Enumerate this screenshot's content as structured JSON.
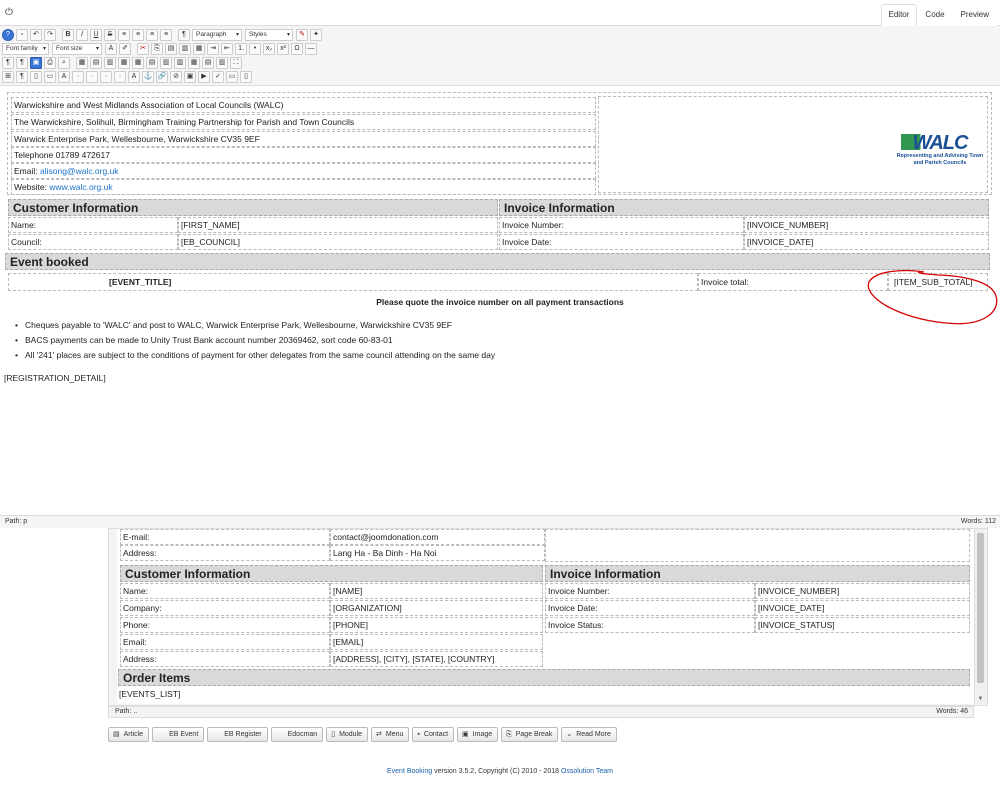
{
  "top_tabs": [
    "Editor",
    "Code",
    "Preview"
  ],
  "toolbar": {
    "format_select": "Paragraph",
    "styles_select": "Styles",
    "font_family_select": "Font family",
    "font_size_select": "Font size"
  },
  "header": {
    "lines": [
      "Warwickshire and West Midlands Association of Local Councils (WALC)",
      "The Warwickshire, Solihull, Birmingham Training Partnership for Parish and Town Councils",
      "Warwick Enterprise Park, Wellesbourne, Warwickshire CV35 9EF",
      "Telephone 01789 472617"
    ],
    "email_label": "Email:",
    "email": "alisong@walc.org.uk",
    "website_label": "Website:",
    "website": "www.walc.org.uk",
    "logo_text": "WALC",
    "logo_tagline": "Representing and Advising Town and Parish Councils"
  },
  "customer_info": {
    "heading": "Customer Information",
    "name_label": "Name:",
    "name_value": "[FIRST_NAME]",
    "council_label": "Council:",
    "council_value": "[EB_COUNCIL]"
  },
  "invoice_info": {
    "heading": "Invoice Information",
    "number_label": "Invoice Number:",
    "number_value": "[INVOICE_NUMBER]",
    "date_label": "Invoice Date:",
    "date_value": "[INVOICE_DATE]"
  },
  "event_booked": {
    "heading": "Event booked",
    "title": "[EVENT_TITLE]",
    "total_label": "Invoice total:",
    "total_value": "[ITEM_SUB_TOTAL]"
  },
  "quote_notice": "Please quote the invoice number on all payment transactions",
  "bullets": [
    "Cheques payable to 'WALC' and post to WALC, Warwick Enterprise Park, Wellesbourne, Warwickshire CV35 9EF",
    "BACS payments can be made to Unity Trust Bank account number 20369462, sort code 60-83-01",
    "All '241' places are subject to the conditions of payment for other delegates from the same council attending on the same day"
  ],
  "registration_detail": "[REGISTRATION_DETAIL]",
  "status": {
    "path": "Path: p",
    "words": "Words: 112"
  },
  "lower": {
    "email_label": "E-mail:",
    "email_value": "contact@joomdonation.com",
    "address_label": "Address:",
    "address_value": "Lang Ha - Ba Dinh - Ha Noi",
    "customer_heading": "Customer Information",
    "invoice_heading": "Invoice Information",
    "cust_rows": [
      {
        "label": "Name:",
        "value": "[NAME]"
      },
      {
        "label": "Company:",
        "value": "[ORGANIZATION]"
      },
      {
        "label": "Phone:",
        "value": "[PHONE]"
      },
      {
        "label": "Email:",
        "value": "[EMAIL]"
      },
      {
        "label": "Address:",
        "value": "[ADDRESS], [CITY], [STATE], [COUNTRY]"
      }
    ],
    "inv_rows": [
      {
        "label": "Invoice Number:",
        "value": "[INVOICE_NUMBER]"
      },
      {
        "label": "Invoice Date:",
        "value": "[INVOICE_DATE]"
      },
      {
        "label": "Invoice Status:",
        "value": "[INVOICE_STATUS]"
      }
    ],
    "order_heading": "Order Items",
    "events_list": "[EVENTS_LIST]",
    "path": "Path: ..",
    "words": "Words: 46"
  },
  "buttons": [
    "Article",
    "EB Event",
    "EB Register",
    "Edocman",
    "Module",
    "Menu",
    "Contact",
    "Image",
    "Page Break",
    "Read More"
  ],
  "footer": {
    "product": "Event Booking",
    "version_text": "version 3.5.2, Copyright (C) 2010 - 2018",
    "team": "Ossolution Team"
  }
}
